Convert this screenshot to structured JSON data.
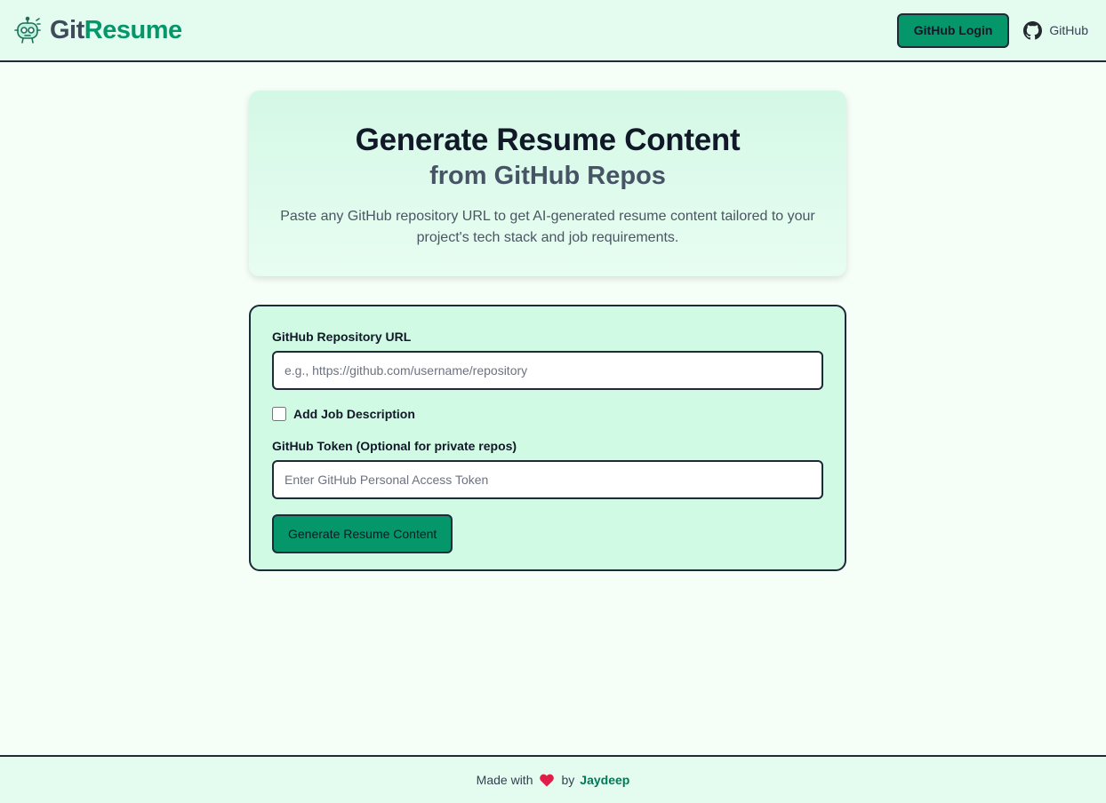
{
  "header": {
    "brand_part1": "Git",
    "brand_part2": "Resume",
    "logo_icon": "robot-icon",
    "login_label": "GitHub Login",
    "github_link_label": "GitHub",
    "github_icon": "github-icon"
  },
  "hero": {
    "title": "Generate Resume Content",
    "subtitle": "from GitHub Repos",
    "description": "Paste any GitHub repository URL to get AI-generated resume content tailored to your project's tech stack and job requirements."
  },
  "form": {
    "repo_url_label": "GitHub Repository URL",
    "repo_url_placeholder": "e.g., https://github.com/username/repository",
    "repo_url_value": "",
    "job_desc_label": "Add Job Description",
    "job_desc_checked": false,
    "token_label": "GitHub Token (Optional for private repos)",
    "token_placeholder": "Enter GitHub Personal Access Token",
    "token_value": "",
    "submit_label": "Generate Resume Content"
  },
  "footer": {
    "made_with": "Made with",
    "heart_icon": "heart-icon",
    "by": "by",
    "author": "Jaydeep"
  },
  "colors": {
    "accent": "#059669",
    "header_bg": "#e3fcef",
    "card_bg": "#d1fae5",
    "page_bg": "#f5fff8",
    "heart": "#e11d48"
  }
}
